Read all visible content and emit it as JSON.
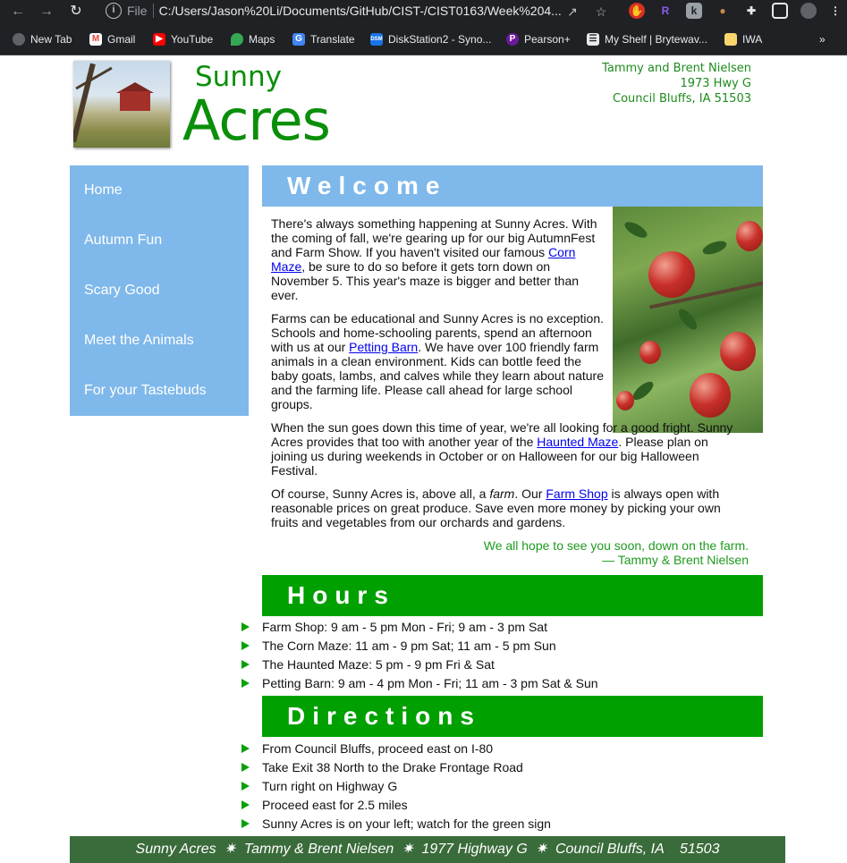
{
  "browser": {
    "scheme": "File",
    "url": "C:/Users/Jason%20Li/Documents/GitHub/CIST-/CIST0163/Week%204...",
    "bookmarks": [
      {
        "label": "New Tab",
        "icon": "globe-icon",
        "color": "#9aa0a6"
      },
      {
        "label": "Gmail",
        "icon": "gmail-icon",
        "color": "#ea4335"
      },
      {
        "label": "YouTube",
        "icon": "youtube-icon",
        "color": "#ff0000"
      },
      {
        "label": "Maps",
        "icon": "maps-icon",
        "color": "#34a853"
      },
      {
        "label": "Translate",
        "icon": "translate-icon",
        "color": "#4285f4"
      },
      {
        "label": "DiskStation2 - Syno...",
        "icon": "dsm-icon",
        "color": "#1a73e8"
      },
      {
        "label": "Pearson+",
        "icon": "pearson-icon",
        "color": "#6a1b9a"
      },
      {
        "label": "My Shelf | Brytewav...",
        "icon": "shelf-icon",
        "color": "#e8eaed"
      },
      {
        "label": "IWA",
        "icon": "folder-icon",
        "color": "#f9d56e"
      }
    ],
    "more_bookmarks": "»"
  },
  "header": {
    "logo_top": "Sunny",
    "logo_bottom": "Acres",
    "address_line1": "Tammy and Brent Nielsen",
    "address_line2": "1973 Hwy G",
    "address_line3": "Council Bluffs, IA  51503"
  },
  "nav": [
    "Home",
    "Autumn Fun",
    "Scary Good",
    "Meet the Animals",
    "For your Tastebuds"
  ],
  "welcome": {
    "heading": "Welcome",
    "p1_a": "There's always something happening at Sunny Acres. With the coming of fall, we're gearing up for our big AutumnFest and Farm Show. If you haven't visited our famous ",
    "p1_link": "Corn Maze",
    "p1_b": ", be sure to do so before it gets torn down on November 5. This year's maze is bigger and better than ever.",
    "p2_a": "Farms can be educational and Sunny Acres is no exception. Schools and home-schooling parents, spend an afternoon with us at our ",
    "p2_link": "Petting Barn",
    "p2_b": ". We have over 100 friendly farm animals in a clean environment. Kids can bottle feed the baby goats, lambs, and calves while they learn about nature and the farming life. Please call ahead for large school groups.",
    "p3_a": "When the sun goes down this time of year, we're all looking for a good fright. Sunny Acres provides that too with another year of the ",
    "p3_link": "Haunted Maze",
    "p3_b": ". Please plan on joining us during weekends in October or on Halloween for our big Halloween Festival.",
    "p4_a": "Of course, Sunny Acres is, above all, a ",
    "p4_em": "farm",
    "p4_b": ". Our ",
    "p4_link": "Farm Shop",
    "p4_c": " is always open with reasonable prices on great produce. Save even more money by picking your own fruits and vegetables from our orchards and gardens.",
    "sign1": "We all hope to see you soon, down on the farm.",
    "sign2": "— Tammy & Brent Nielsen"
  },
  "hours": {
    "heading": "Hours",
    "items": [
      "Farm Shop: 9 am - 5 pm Mon - Fri; 9 am - 3 pm Sat",
      "The Corn Maze: 11 am - 9 pm Sat; 11 am - 5 pm Sun",
      "The Haunted Maze: 5 pm - 9 pm Fri & Sat",
      "Petting Barn: 9 am - 4 pm Mon - Fri; 11 am - 3 pm Sat & Sun"
    ]
  },
  "directions": {
    "heading": "Directions",
    "items": [
      "From Council Bluffs, proceed east on I-80",
      "Take Exit 38 North to the Drake Frontage Road",
      "Turn right on Highway G",
      "Proceed east for 2.5 miles",
      "Sunny Acres is on your left; watch for the green sign"
    ]
  },
  "footer": "Sunny Acres  ✷  Tammy & Brent Nielsen  ✷  1977 Highway G  ✷  Council Bluffs, IA    51503"
}
